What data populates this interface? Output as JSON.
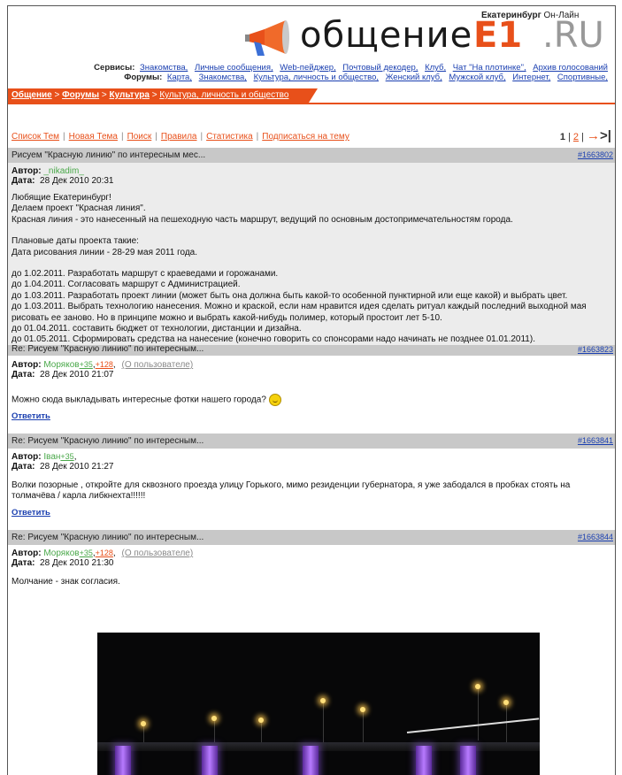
{
  "site": {
    "city_bold": "Екатеринбург",
    "city_rest": " Он-Лайн",
    "logo_word": "общение",
    "logo_e1": "E1",
    "logo_ru": ".RU"
  },
  "services": {
    "label": "Сервисы:",
    "items": [
      "Знакомства,",
      "Личные сообщения,",
      "Web-пейджер,",
      "Почтовый декодер,",
      "Клуб,",
      "Чат \"На плотинке\",",
      "Архив голосований"
    ]
  },
  "forums": {
    "label": "Форумы:",
    "items": [
      "Карта,",
      "Знакомства,",
      "Культура, личность и общество,",
      "Женский клуб,",
      "Мужской клуб,",
      "Интернет,",
      "Спортивные,"
    ]
  },
  "breadcrumb": {
    "items": [
      "Общение",
      " > ",
      "Форумы",
      " > ",
      "Культура",
      " > ",
      "Культура, личность и общество"
    ]
  },
  "nav": {
    "items": [
      "Список Тем",
      "Новая Тема",
      "Поиск",
      "Правила",
      "Статистика",
      "Подписаться на тему"
    ],
    "separator": "|"
  },
  "pager": {
    "current": "1",
    "sep1": " | ",
    "next_page": "2",
    "sep2": " | ",
    "next_arrow": "→",
    "last_arrow": ">|"
  },
  "posts": [
    {
      "title": "Рисуем \"Красную линию\" по интересным мес...",
      "id": "#1663802",
      "author_label": "Автор:",
      "author": "_nikadim_",
      "date_label": "Дата:",
      "date": "28 Дек 2010 20:31",
      "paragraphs": [
        [
          "Любящие Екатеринбург!",
          "Делаем проект \"Красная линия\".",
          "Красная линия - это нанесенный на пешеходную часть маршрут, ведущий по основным достопримечательностям города."
        ],
        [
          "Плановые даты проекта такие:",
          "Дата рисования линии - 28-29 мая 2011 года."
        ],
        [
          "до 1.02.2011. Разработать маршрут с краеведами и горожанами.",
          "до 1.04.2011. Согласовать маршрут с Администрацией.",
          "до 1.03.2011. Разработать проект линии (может быть она должна быть какой-то особенной пунктирной или еще какой) и выбрать цвет.",
          "до 1.03.2011. Выбрать технологию нанесения. Можно и краской, если нам нравится идея сделать ритуал каждый последний выходной мая рисовать ее заново. Но в принципе можно и выбрать какой-нибудь полимер, который простоит лет 5-10.",
          "до 01.04.2011. составить бюджет от технологии, дистанции и дизайна.",
          "до 01.05.2011. Сформировать средства на нанесение (конечно говорить со спонсорами надо начинать не позднее 01.01.2011)."
        ]
      ]
    },
    {
      "title": "Re: Рисуем \"Красную линию\" по интересным...",
      "id": "#1663823",
      "author_label": "Автор:",
      "author": "Моряков",
      "rep1": "+35",
      "rep2": "+128",
      "about": "(О пользователе)",
      "date_label": "Дата:",
      "date": "28 Дек 2010 21:07",
      "text": "Можно сюда выкладывать интересные фотки нашего города?",
      "reply": "Ответить"
    },
    {
      "title": "Re: Рисуем \"Красную линию\" по интересным...",
      "id": "#1663841",
      "author_label": "Автор:",
      "author": "Іван",
      "rep1": "+35",
      "date_label": "Дата:",
      "date": "28 Дек 2010 21:27",
      "text": "Волки позорные , откройте для сквозного проезда улицу Горького, мимо резиденции губернатора, я уже забодался в пробках стоять на толмачёва / карла либкнехта!!!!!!",
      "reply": "Ответить"
    },
    {
      "title": "Re: Рисуем \"Красную линию\" по интересным...",
      "id": "#1663844",
      "author_label": "Автор:",
      "author": "Моряков",
      "rep1": "+35",
      "rep2": "+128",
      "about": "(О пользователе)",
      "date_label": "Дата:",
      "date": "28 Дек 2010 21:30",
      "text": "Молчание - знак согласия."
    }
  ],
  "colors": {
    "accent": "#e8501a",
    "link": "#1a3fb0",
    "header_bar": "#c8c8c8",
    "post_bg": "#ececec",
    "nick_green": "#4aa84a"
  }
}
